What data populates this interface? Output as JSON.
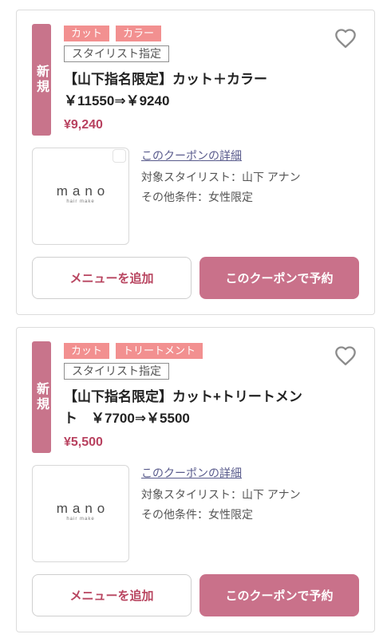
{
  "colors": {
    "badge": "#c8748b",
    "tag": "#f29090",
    "price": "#b8415f",
    "accent-button": "#c9718a",
    "accent-text": "#b8445f",
    "link": "#595b8c"
  },
  "icons": {
    "favorite": "heart-icon"
  },
  "coupons": [
    {
      "badge": "新規",
      "tags": [
        "カット",
        "カラー"
      ],
      "stylist_tag": "スタイリスト指定",
      "title": "【山下指名限定】カット＋カラー　￥11550⇒￥9240",
      "price": "¥9,240",
      "image": {
        "logo_text": "mano",
        "logo_subtext": "hair make"
      },
      "detail_link": "このクーポンの詳細",
      "stylist": "対象スタイリスト：山下 アナン",
      "conditions": "その他条件：女性限定",
      "add_menu_label": "メニューを追加",
      "reserve_label": "このクーポンで予約"
    },
    {
      "badge": "新規",
      "tags": [
        "カット",
        "トリートメント"
      ],
      "stylist_tag": "スタイリスト指定",
      "title": "【山下指名限定】カット+トリートメント　￥7700⇒￥5500",
      "price": "¥5,500",
      "image": {
        "logo_text": "mano",
        "logo_subtext": "hair make"
      },
      "detail_link": "このクーポンの詳細",
      "stylist": "対象スタイリスト：山下 アナン",
      "conditions": "その他条件：女性限定",
      "add_menu_label": "メニューを追加",
      "reserve_label": "このクーポンで予約"
    }
  ]
}
